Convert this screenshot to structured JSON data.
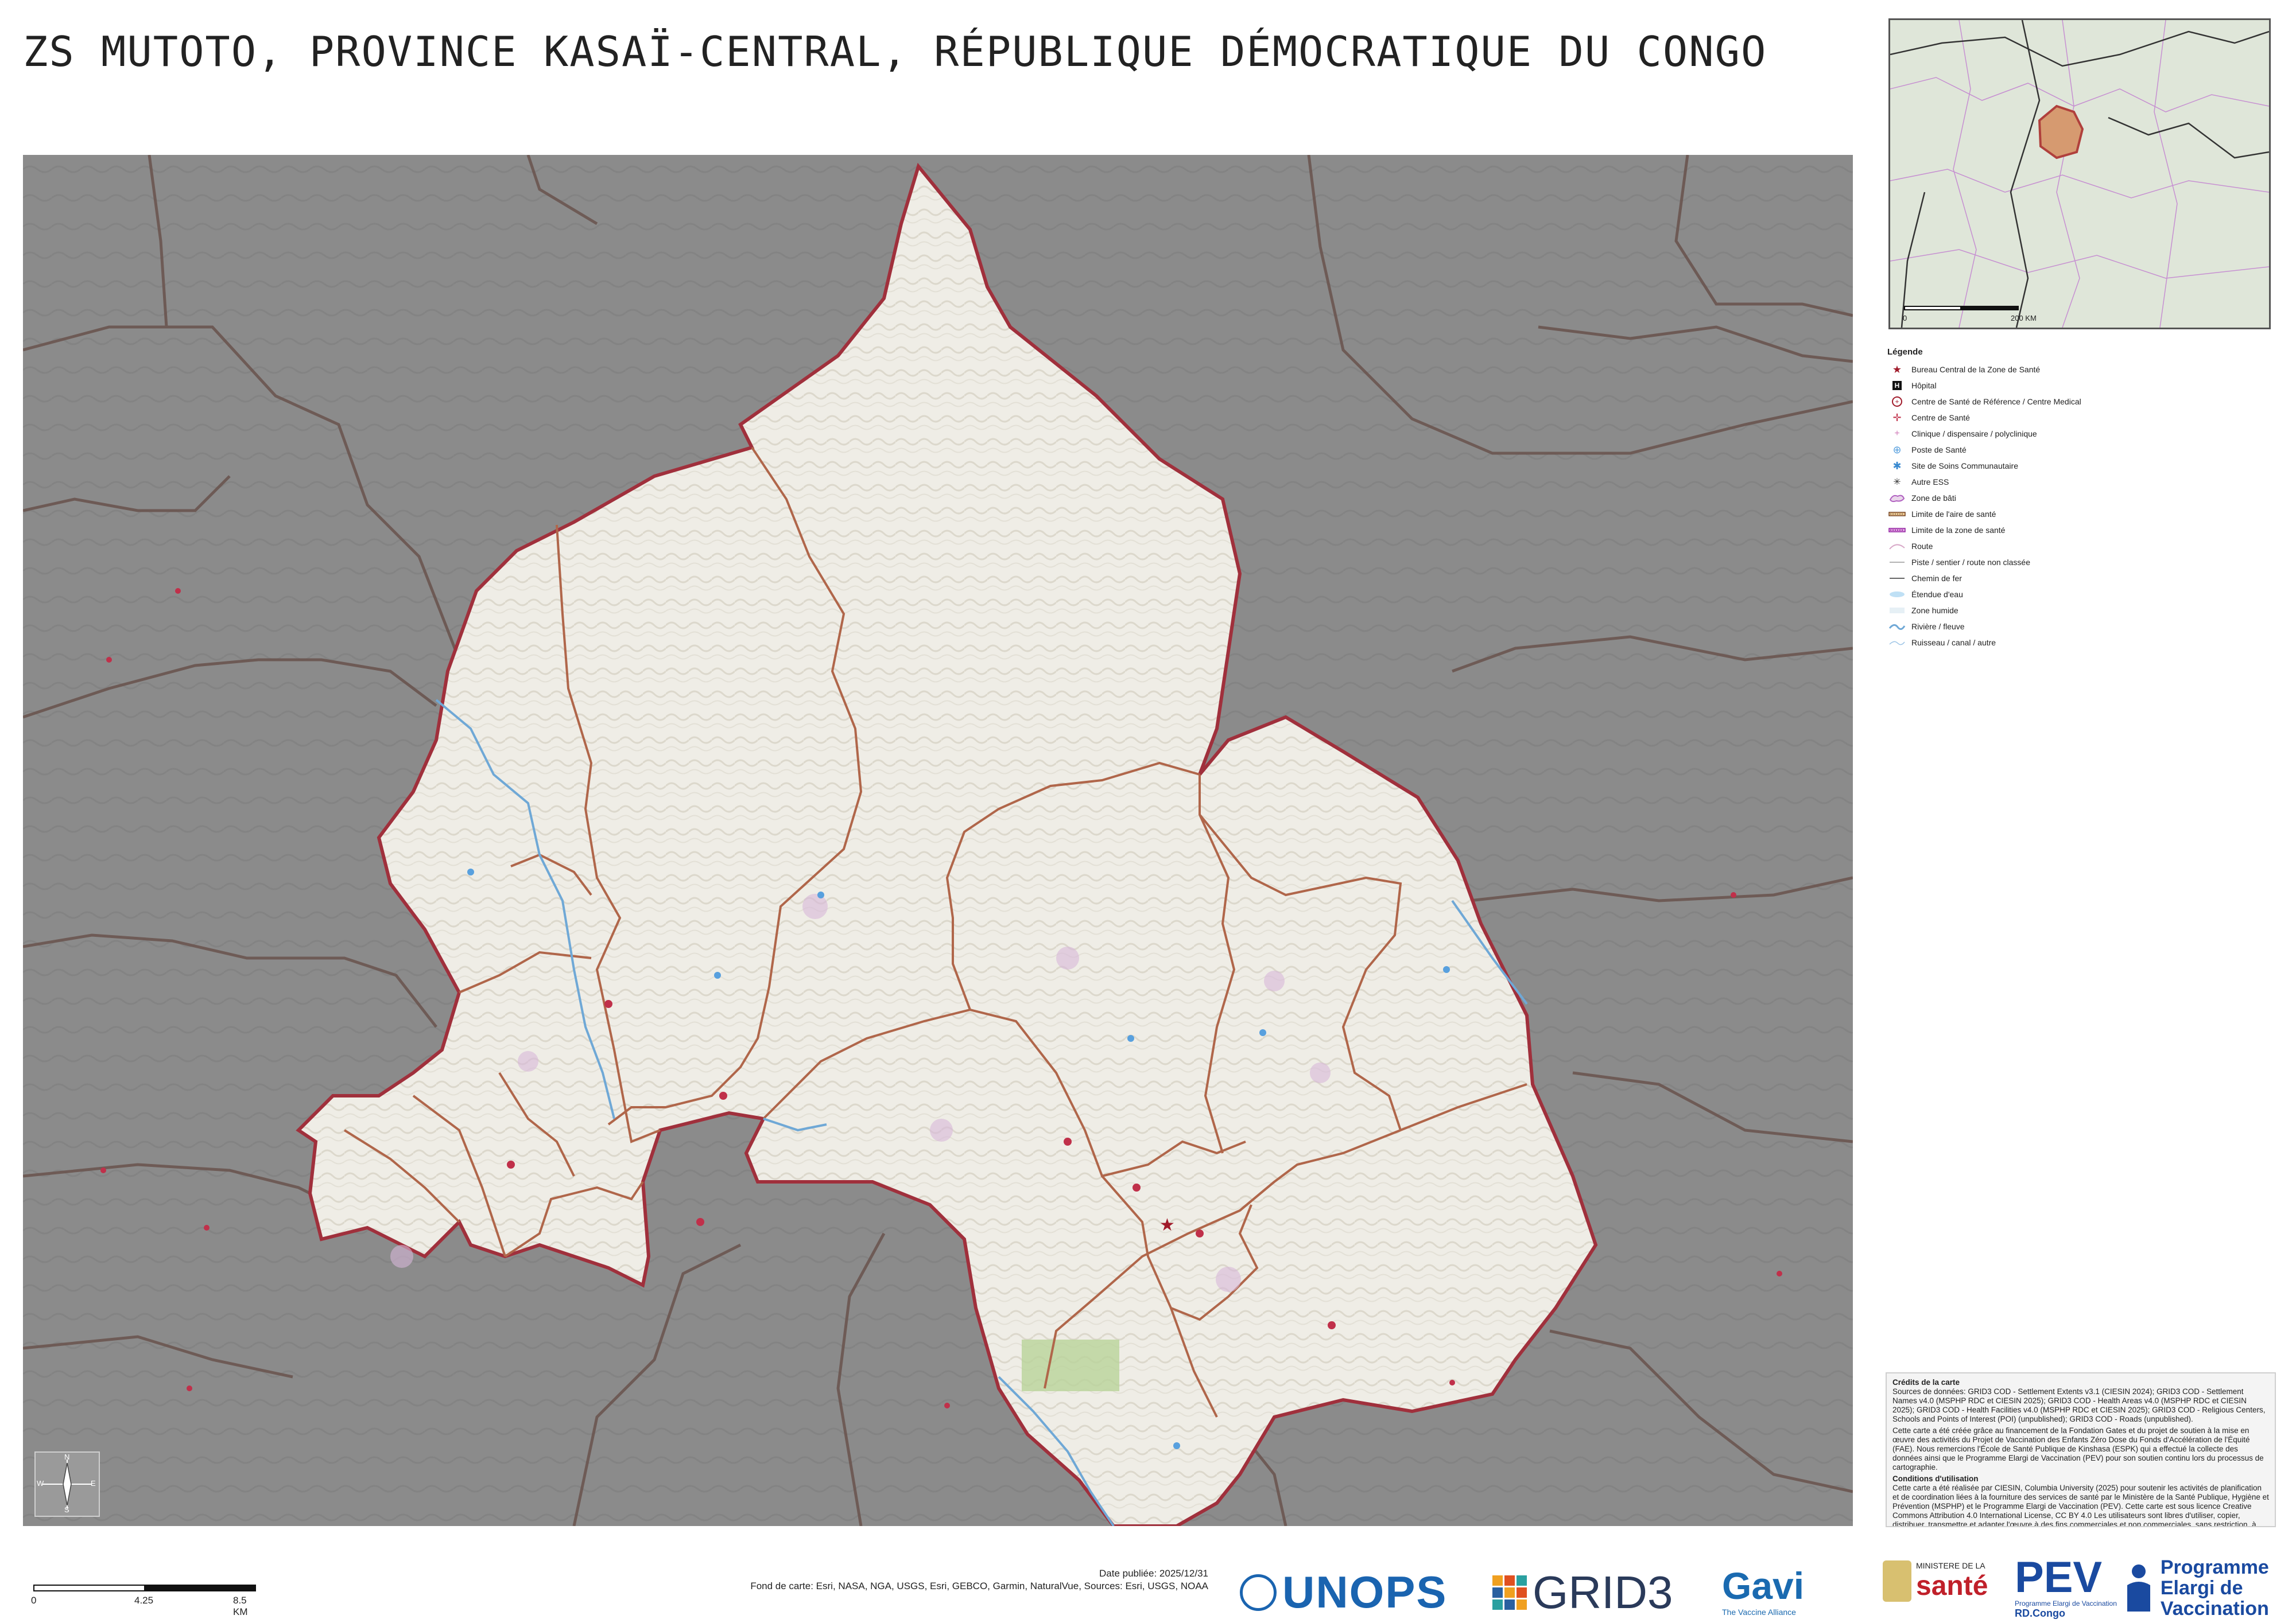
{
  "title": "ZS MUTOTO, PROVINCE KASAÏ-CENTRAL, RÉPUBLIQUE DÉMOCRATIQUE DU CONGO",
  "inset": {
    "scale_start": "0",
    "scale_end": "200 KM"
  },
  "legend": {
    "title": "Légende",
    "items": [
      {
        "label": "Bureau Central de la Zone de Santé",
        "icon": "star-icon"
      },
      {
        "label": "Hôpital",
        "icon": "hospital-icon"
      },
      {
        "label": "Centre de Santé de Référence / Centre Medical",
        "icon": "reference-center-icon"
      },
      {
        "label": "Centre de Santé",
        "icon": "health-center-icon"
      },
      {
        "label": "Clinique / dispensaire / polyclinique",
        "icon": "clinic-icon"
      },
      {
        "label": "Poste de Santé",
        "icon": "health-post-icon"
      },
      {
        "label": "Site de Soins Communautaire",
        "icon": "community-site-icon"
      },
      {
        "label": "Autre ESS",
        "icon": "other-facility-icon"
      },
      {
        "label": "Zone de bâti",
        "icon": "builtup-icon"
      },
      {
        "label": "Limite de l'aire de santé",
        "icon": "health-area-boundary-icon"
      },
      {
        "label": "Limite de la zone de santé",
        "icon": "health-zone-boundary-icon"
      },
      {
        "label": "Route",
        "icon": "road-icon"
      },
      {
        "label": "Piste / sentier / route non classée",
        "icon": "track-icon"
      },
      {
        "label": "Chemin de fer",
        "icon": "railway-icon"
      },
      {
        "label": "Étendue d'eau",
        "icon": "waterbody-icon"
      },
      {
        "label": "Zone humide",
        "icon": "wetland-icon"
      },
      {
        "label": "Rivière / fleuve",
        "icon": "river-icon"
      },
      {
        "label": "Ruisseau / canal / autre",
        "icon": "stream-icon"
      }
    ]
  },
  "credits": {
    "heading": "Crédits de la carte",
    "sources": "Sources de données: GRID3 COD - Settlement Extents v3.1 (CIESIN 2024); GRID3 COD - Settlement Names v4.0 (MSPHP RDC et CIESIN 2025); GRID3 COD - Health Areas v4.0 (MSPHP RDC et CIESIN 2025); GRID3 COD - Health Facilities v4.0 (MSPHP RDC et CIESIN 2025); GRID3 COD - Religious Centers, Schools and Points of Interest (POI) (unpublished); GRID3 COD - Roads (unpublished).",
    "funding": "Cette carte a été créée grâce au financement de la Fondation Gates et du projet de soutien à la mise en œuvre des activités du Projet de Vaccination des Enfants Zéro Dose du Fonds d'Accélération de l'Équité (FAE). Nous remercions l'École de Santé Publique de Kinshasa (ESPK) qui a effectué la collecte des données ainsi que le Programme Elargi de Vaccination (PEV) pour son soutien continu lors du processus de cartographie.",
    "conditions_heading": "Conditions d'utilisation",
    "conditions": "Cette carte a été réalisée par CIESIN, Columbia University (2025) pour soutenir les activités de planification et de coordination liées à la fourniture des services de santé par le Ministère de la Santé Publique, Hygiène et Prévention (MSPHP) et le Programme Elargi de Vaccination (PEV). Cette carte est sous licence Creative Commons Attribution 4.0 International License, CC BY 4.0 Les utilisateurs sont libres d'utiliser, copier, distribuer, transmettre et adapter l'œuvre à des fins commerciales et non commerciales, sans restriction, à condition qu'une attribution claire de la source soit fournie."
  },
  "scalebar": {
    "l0": "0",
    "l1": "4.25",
    "l2": "8.5 KM"
  },
  "publication": {
    "date": "Date publiée: 2025/12/31",
    "basemap": "Fond de carte: Esri, NASA, NGA, USGS, Esri, GEBCO, Garmin, NaturalVue, Sources: Esri, USGS, NOAA"
  },
  "logos": {
    "unops": "UNOPS",
    "grid3": "GRID3",
    "gavi": "Gavi",
    "gavi_sub": "The Vaccine Alliance",
    "ministry_top": "MINISTERE DE LA",
    "ministry_main": "santé",
    "pev": "PEV",
    "pev_sub1": "Programme Elargi de Vaccination",
    "pev_sub2": "RD.Congo",
    "pev_right1": "Programme",
    "pev_right2": "Elargi de",
    "pev_right3": "Vaccination"
  },
  "compass": {
    "n": "N",
    "s": "S",
    "e": "E",
    "w": "W"
  },
  "colors": {
    "outside": "#8a8a8a",
    "zone_fill": "#efede6",
    "health_area_line": "#b0664a",
    "zone_boundary": "#a0303c",
    "river": "#6fa8d6",
    "wetland": "#b9d39a"
  }
}
